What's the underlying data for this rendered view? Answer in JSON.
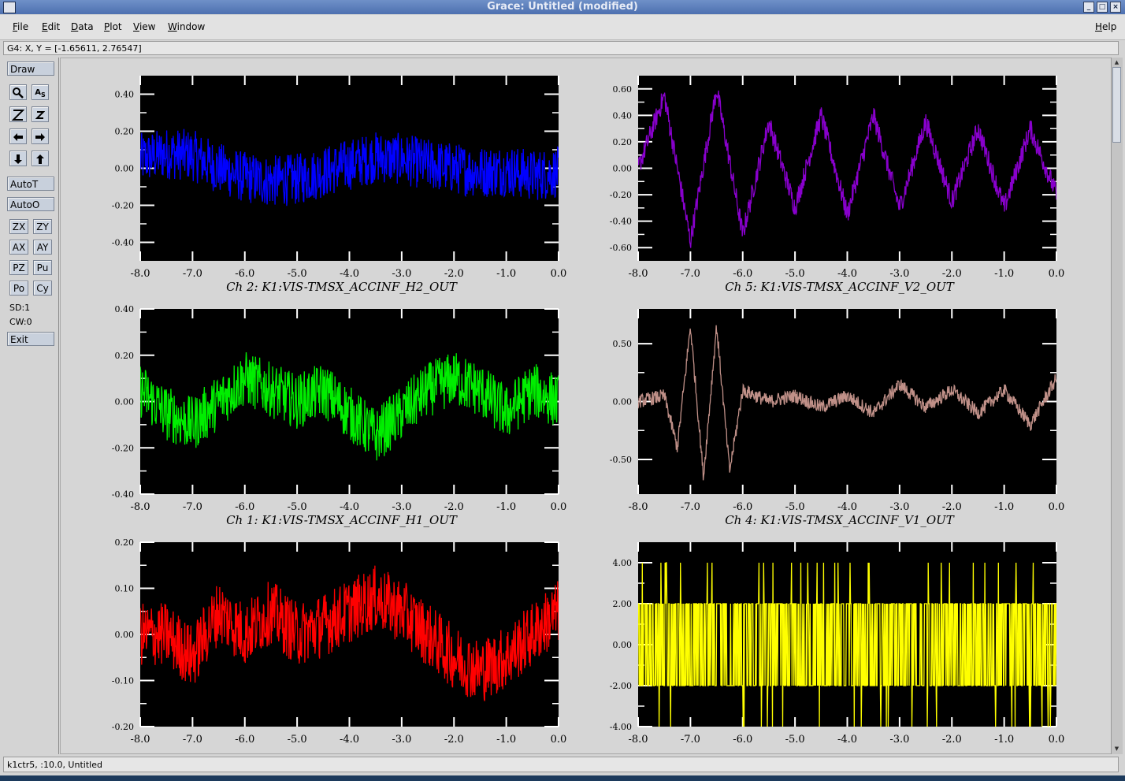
{
  "window": {
    "title": "Grace: Untitled (modified)",
    "minimize": "_",
    "maximize": "□",
    "close": "×"
  },
  "menubar": {
    "items": [
      "File",
      "Edit",
      "Data",
      "Plot",
      "View",
      "Window"
    ],
    "help": "Help"
  },
  "coord_readout": "G4: X, Y = [-1.65611, 2.76547]",
  "toolbar": {
    "draw": "Draw",
    "autot": "AutoT",
    "autoo": "AutoO",
    "exit": "Exit",
    "zx": "ZX",
    "zy": "ZY",
    "ax": "AX",
    "ay": "AY",
    "pz": "PZ",
    "pu": "Pu",
    "po": "Po",
    "cy": "Cy",
    "sd": "SD:1",
    "cw": "CW:0",
    "icons": [
      "magnifier-icon",
      "autoscale-icon",
      "zoom-in-icon",
      "zoom-out-icon",
      "arrow-left-icon",
      "arrow-right-icon",
      "arrow-down-icon",
      "arrow-up-icon"
    ]
  },
  "status": "k1ctr5, :10.0, Untitled",
  "chart_data": [
    {
      "type": "line",
      "title": "Ch 2:  K1:VIS-TMSX_ACCINF_H2_OUT",
      "color": "#0000ff",
      "xlim": [
        -8.0,
        0.0
      ],
      "ylim": [
        -0.5,
        0.5
      ],
      "xticks": [
        "-8.0",
        "-7.0",
        "-6.0",
        "-5.0",
        "-4.0",
        "-3.0",
        "-2.0",
        "-1.0",
        "0.0"
      ],
      "yticks": [
        {
          "v": 0.4,
          "l": "0.40"
        },
        {
          "v": 0.2,
          "l": "0.20"
        },
        {
          "v": 0.0,
          "l": "0.00"
        },
        {
          "v": -0.2,
          "l": "-0.20"
        },
        {
          "v": -0.4,
          "l": "-0.40"
        }
      ],
      "series": [
        {
          "x": [
            -8.0,
            -7.5,
            -7.0,
            -6.5,
            -6.0,
            -5.5,
            -5.0,
            -4.5,
            -4.0,
            -3.5,
            -3.0,
            -2.5,
            -2.0,
            -1.5,
            -1.0,
            -0.5,
            0.0
          ],
          "y": [
            0.05,
            0.08,
            0.07,
            0.0,
            -0.05,
            -0.07,
            -0.06,
            -0.02,
            0.02,
            0.06,
            0.05,
            0.02,
            0.0,
            -0.02,
            -0.01,
            -0.04,
            -0.02
          ],
          "noise": 0.14
        }
      ]
    },
    {
      "type": "line",
      "title": "Ch 5:  K1:VIS-TMSX_ACCINF_V2_OUT",
      "color": "#8800cc",
      "xlim": [
        -8.0,
        0.0
      ],
      "ylim": [
        -0.7,
        0.7
      ],
      "xticks": [
        "-8.0",
        "-7.0",
        "-6.0",
        "-5.0",
        "-4.0",
        "-3.0",
        "-2.0",
        "-1.0",
        "0.0"
      ],
      "yticks": [
        {
          "v": 0.6,
          "l": "0.60"
        },
        {
          "v": 0.4,
          "l": "0.40"
        },
        {
          "v": 0.2,
          "l": "0.20"
        },
        {
          "v": 0.0,
          "l": "0.00"
        },
        {
          "v": -0.2,
          "l": "-0.20"
        },
        {
          "v": -0.4,
          "l": "-0.40"
        },
        {
          "v": -0.6,
          "l": "-0.60"
        }
      ],
      "series": [
        {
          "x": [
            -8.0,
            -7.5,
            -7.0,
            -6.5,
            -6.0,
            -5.5,
            -5.0,
            -4.5,
            -4.0,
            -3.5,
            -3.0,
            -2.5,
            -2.0,
            -1.5,
            -1.0,
            -0.5,
            0.0
          ],
          "y": [
            0.0,
            0.55,
            -0.55,
            0.6,
            -0.5,
            0.35,
            -0.3,
            0.4,
            -0.35,
            0.4,
            -0.3,
            0.35,
            -0.25,
            0.3,
            -0.3,
            0.3,
            -0.2
          ],
          "noise": 0.08
        }
      ]
    },
    {
      "type": "line",
      "title": "Ch 1:  K1:VIS-TMSX_ACCINF_H1_OUT",
      "color": "#00ee00",
      "xlim": [
        -8.0,
        0.0
      ],
      "ylim": [
        -0.4,
        0.4
      ],
      "xticks": [
        "-8.0",
        "-7.0",
        "-6.0",
        "-5.0",
        "-4.0",
        "-3.0",
        "-2.0",
        "-1.0",
        "0.0"
      ],
      "yticks": [
        {
          "v": 0.4,
          "l": "0.40"
        },
        {
          "v": 0.2,
          "l": "0.20"
        },
        {
          "v": 0.0,
          "l": "0.00"
        },
        {
          "v": -0.2,
          "l": "-0.20"
        },
        {
          "v": -0.4,
          "l": "-0.40"
        }
      ],
      "series": [
        {
          "x": [
            -8.0,
            -7.5,
            -7.0,
            -6.5,
            -6.0,
            -5.5,
            -5.0,
            -4.5,
            -4.0,
            -3.5,
            -3.0,
            -2.5,
            -2.0,
            -1.5,
            -1.0,
            -0.5,
            0.0
          ],
          "y": [
            0.05,
            -0.05,
            -0.1,
            0.0,
            0.1,
            0.05,
            0.0,
            0.05,
            -0.05,
            -0.15,
            -0.05,
            0.05,
            0.1,
            0.05,
            -0.05,
            0.05,
            0.0
          ],
          "noise": 0.12
        }
      ]
    },
    {
      "type": "line",
      "title": "Ch 4:  K1:VIS-TMSX_ACCINF_V1_OUT",
      "color": "#c09088",
      "xlim": [
        -8.0,
        0.0
      ],
      "ylim": [
        -0.8,
        0.8
      ],
      "xticks": [
        "-8.0",
        "-7.0",
        "-6.0",
        "-5.0",
        "-4.0",
        "-3.0",
        "-2.0",
        "-1.0",
        "0.0"
      ],
      "yticks": [
        {
          "v": 0.5,
          "l": "0.50"
        },
        {
          "v": 0.0,
          "l": "0.00"
        },
        {
          "v": -0.5,
          "l": "-0.50"
        }
      ],
      "series": [
        {
          "x": [
            -8.0,
            -7.5,
            -7.25,
            -7.0,
            -6.75,
            -6.5,
            -6.25,
            -6.0,
            -5.5,
            -5.0,
            -4.5,
            -4.0,
            -3.5,
            -3.0,
            -2.5,
            -2.0,
            -1.5,
            -1.0,
            -0.5,
            0.0
          ],
          "y": [
            0.0,
            0.05,
            -0.4,
            0.65,
            -0.65,
            0.65,
            -0.6,
            0.1,
            0.0,
            0.05,
            -0.05,
            0.05,
            -0.1,
            0.15,
            -0.05,
            0.1,
            -0.1,
            0.1,
            -0.2,
            0.2
          ],
          "noise": 0.06
        }
      ]
    },
    {
      "type": "line",
      "title": "",
      "color": "#ffff00",
      "xlim": [
        -8.0,
        0.0
      ],
      "ylim": [
        -0.2,
        0.2
      ],
      "xticks": [
        "-8.0",
        "-7.0",
        "-6.0",
        "-5.0",
        "-4.0",
        "-3.0",
        "-2.0",
        "-1.0",
        "0.0"
      ],
      "yticks": [
        {
          "v": 0.2,
          "l": "0.20"
        },
        {
          "v": 0.1,
          "l": "0.10"
        },
        {
          "v": 0.0,
          "l": "0.00"
        },
        {
          "v": -0.1,
          "l": "-0.10"
        },
        {
          "v": -0.2,
          "l": "-0.20"
        }
      ],
      "series": [
        {
          "x": [
            -8.0,
            -7.5,
            -7.0,
            -6.5,
            -6.0,
            -5.5,
            -5.0,
            -4.5,
            -4.0,
            -3.5,
            -3.0,
            -2.5,
            -2.0,
            -1.5,
            -1.0,
            -0.5,
            0.0
          ],
          "y": [
            0.0,
            0.0,
            -0.05,
            0.05,
            0.0,
            0.05,
            0.0,
            0.02,
            0.05,
            0.08,
            0.05,
            0.0,
            -0.05,
            -0.08,
            -0.05,
            0.0,
            0.05
          ],
          "noise": 0.07,
          "color": "#ff0000"
        }
      ]
    },
    {
      "type": "line",
      "title": "",
      "color": "#ffff00",
      "xlim": [
        -8.0,
        0.0
      ],
      "ylim": [
        -4.0,
        5.0
      ],
      "xticks": [
        "-8.0",
        "-7.0",
        "-6.0",
        "-5.0",
        "-4.0",
        "-3.0",
        "-2.0",
        "-1.0",
        "0.0"
      ],
      "yticks": [
        {
          "v": 4.0,
          "l": "4.00"
        },
        {
          "v": 2.0,
          "l": "2.00"
        },
        {
          "v": 0.0,
          "l": "0.00"
        },
        {
          "v": -2.0,
          "l": "-2.00"
        },
        {
          "v": -4.0,
          "l": "-4.00"
        }
      ],
      "series": [
        {
          "x": [
            -8.0,
            0.0
          ],
          "y": [
            2.0,
            -2.0
          ],
          "levels": [
            4.0,
            2.0,
            0.0,
            -2.0,
            -4.0
          ],
          "noise": 0
        }
      ]
    }
  ]
}
